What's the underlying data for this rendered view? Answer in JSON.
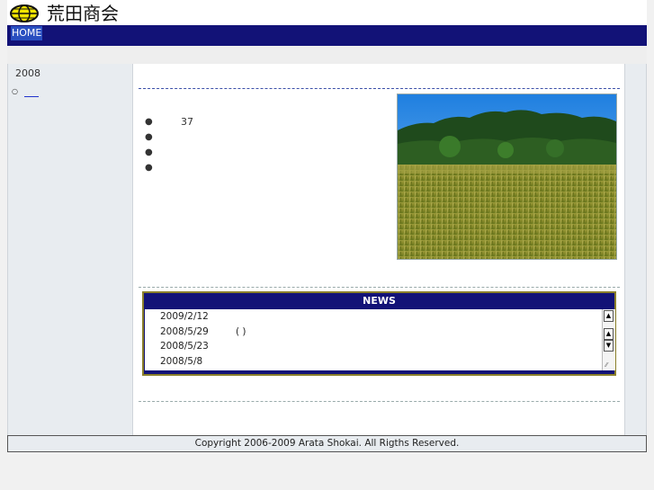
{
  "header": {
    "title": "荒田商会"
  },
  "nav": {
    "home_label": "HOME"
  },
  "sidebar": {
    "year": "2008"
  },
  "main": {
    "bullets": [
      {
        "text": "37"
      },
      {
        "text": ""
      },
      {
        "text": ""
      },
      {
        "text": ""
      }
    ],
    "photo_icon": "rice-field-photo"
  },
  "news": {
    "title": "NEWS",
    "items": [
      {
        "date": "2009/2/12",
        "text": ""
      },
      {
        "date": "2008/5/29",
        "text": "(      )"
      },
      {
        "date": "2008/5/23",
        "text": ""
      },
      {
        "date": "2008/5/8",
        "text": ""
      }
    ]
  },
  "footer": {
    "copyright": "Copyright 2006-2009 Arata Shokai. All Rigths Reserved."
  },
  "colors": {
    "nav_bg": "#121277",
    "logo_yellow": "#f2e500",
    "news_border": "#8a7f2a"
  }
}
